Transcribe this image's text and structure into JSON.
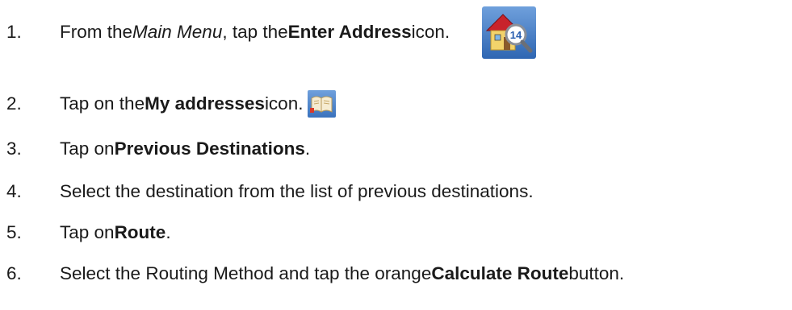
{
  "steps": [
    {
      "number": "1.",
      "parts": [
        "From the ",
        "Main Menu",
        ", tap the ",
        "Enter Address",
        " icon."
      ],
      "icon": "enter-address-icon"
    },
    {
      "number": "2.",
      "parts": [
        "Tap on the ",
        "My addresses",
        " icon."
      ],
      "icon": "my-addresses-icon"
    },
    {
      "number": "3.",
      "parts": [
        "Tap on ",
        "Previous Destinations",
        "."
      ]
    },
    {
      "number": "4.",
      "parts": [
        "Select the destination from the list of previous destinations."
      ]
    },
    {
      "number": "5.",
      "parts": [
        "Tap on ",
        "Route",
        "."
      ]
    },
    {
      "number": "6.",
      "parts": [
        "Select the Routing Method and tap the orange ",
        "Calculate Route",
        " button."
      ]
    }
  ],
  "icon_badge_number": "14",
  "colors": {
    "text": "#1a1a1a",
    "icon_background": "#3f79c4",
    "house_roof": "#c8232c",
    "house_wall": "#f3d36b"
  }
}
